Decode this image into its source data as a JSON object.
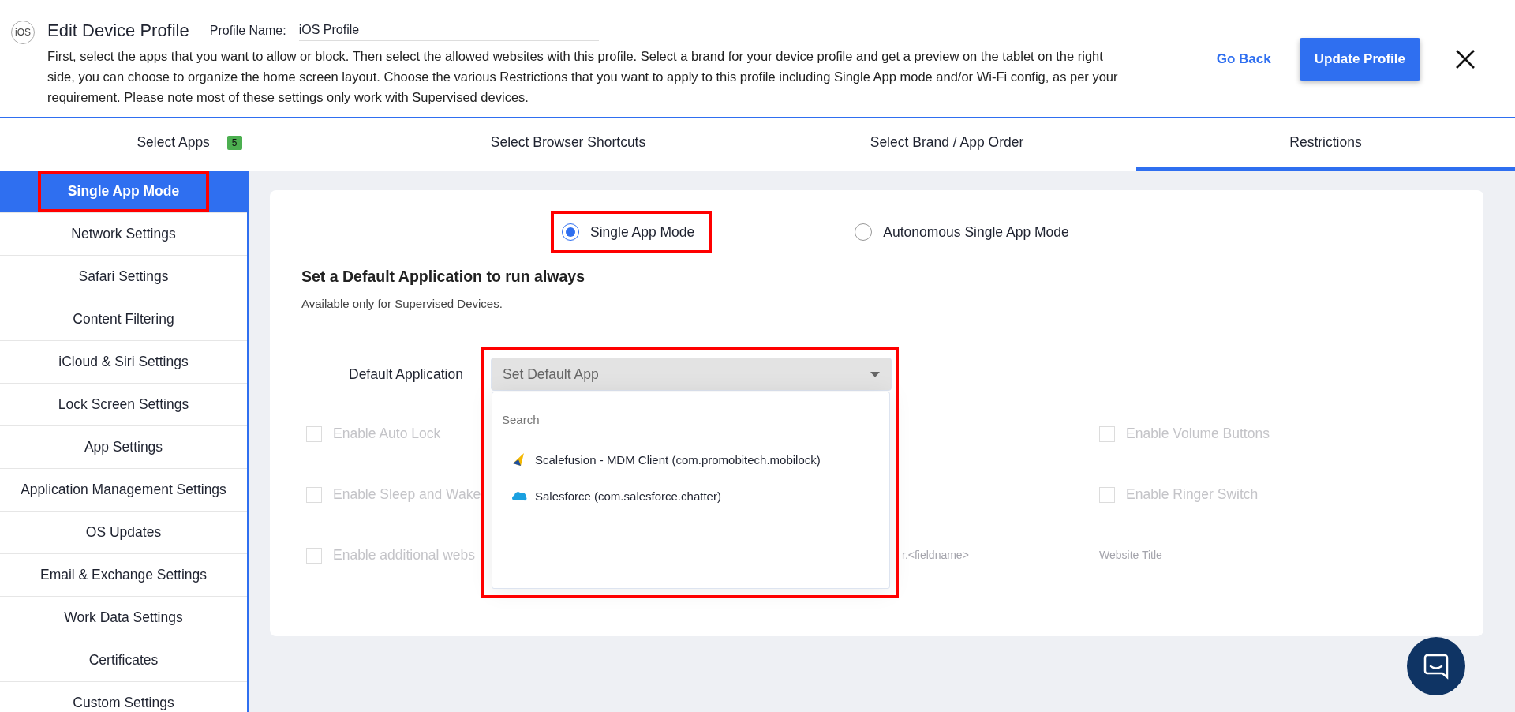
{
  "header": {
    "logo_text": "iOS",
    "title": "Edit Device Profile",
    "profile_name_label": "Profile Name:",
    "profile_name_value": "iOS Profile",
    "description": "First, select the apps that you want to allow or block. Then select the allowed websites with this profile. Select a brand for your device profile and get a preview on the tablet on the right side, you can choose to organize the home screen layout. Choose the various Restrictions that you want to apply to this profile including Single App mode and/or Wi-Fi config, as per your requirement. Please note most of these settings only work with Supervised devices.",
    "go_back": "Go Back",
    "update_button": "Update Profile"
  },
  "tabs": [
    {
      "label": "Select Apps",
      "badge": "5",
      "selected": false
    },
    {
      "label": "Select Browser Shortcuts",
      "selected": false
    },
    {
      "label": "Select Brand / App Order",
      "selected": false
    },
    {
      "label": "Restrictions",
      "selected": true
    }
  ],
  "sidebar": {
    "items": [
      {
        "label": "Single App Mode",
        "selected": true,
        "highlighted": true
      },
      {
        "label": "Network Settings",
        "selected": false,
        "highlighted": false
      },
      {
        "label": "Safari Settings",
        "selected": false,
        "highlighted": false
      },
      {
        "label": "Content Filtering",
        "selected": false,
        "highlighted": false
      },
      {
        "label": "iCloud & Siri Settings",
        "selected": false,
        "highlighted": false
      },
      {
        "label": "Lock Screen Settings",
        "selected": false,
        "highlighted": false
      },
      {
        "label": "App Settings",
        "selected": false,
        "highlighted": false
      },
      {
        "label": "Application Management Settings",
        "selected": false,
        "highlighted": false
      },
      {
        "label": "OS Updates",
        "selected": false,
        "highlighted": false
      },
      {
        "label": "Email & Exchange Settings",
        "selected": false,
        "highlighted": false
      },
      {
        "label": "Work Data Settings",
        "selected": false,
        "highlighted": false
      },
      {
        "label": "Certificates",
        "selected": false,
        "highlighted": false
      },
      {
        "label": "Custom Settings",
        "selected": false,
        "highlighted": false
      }
    ]
  },
  "mode_options": [
    {
      "label": "Single App Mode",
      "selected": true,
      "highlighted": true
    },
    {
      "label": "Autonomous Single App Mode",
      "selected": false,
      "highlighted": false
    }
  ],
  "section": {
    "title": "Set a Default Application to run always",
    "subtitle": "Available only for Supervised Devices."
  },
  "default_app": {
    "label": "Default Application",
    "placeholder": "Set Default App",
    "expanded": true,
    "highlighted": true,
    "search_placeholder": "Search",
    "options": [
      "Scalefusion - MDM Client (com.promobitech.mobilock)",
      "Salesforce (com.salesforce.chatter)"
    ]
  },
  "checkboxes_left": [
    {
      "label": "Enable Auto Lock",
      "checked": false,
      "disabled": true
    },
    {
      "label": "Enable Sleep and Wake",
      "checked": false,
      "disabled": true
    },
    {
      "label": "Enable additional webs",
      "checked": false,
      "disabled": true
    }
  ],
  "checkboxes_right": [
    {
      "label": "Enable Volume Buttons",
      "checked": false,
      "disabled": true
    },
    {
      "label": "Enable Ringer Switch",
      "checked": false,
      "disabled": true
    }
  ],
  "fields": [
    {
      "placeholder": "r.<fieldname>"
    },
    {
      "placeholder": "Website Title"
    }
  ]
}
